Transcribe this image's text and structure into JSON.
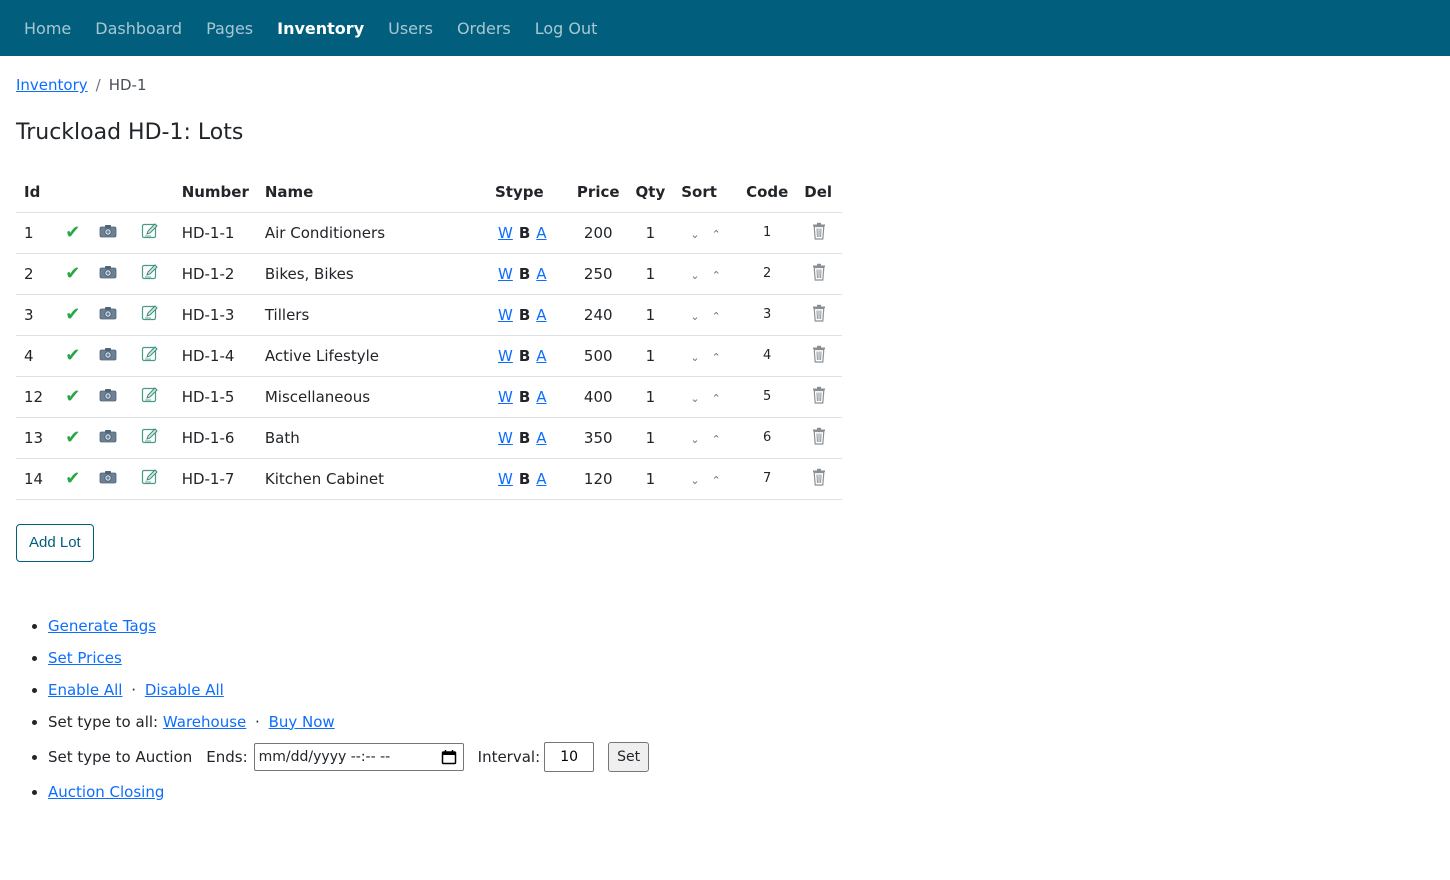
{
  "nav": {
    "items": [
      {
        "label": "Home"
      },
      {
        "label": "Dashboard"
      },
      {
        "label": "Pages"
      },
      {
        "label": "Inventory"
      },
      {
        "label": "Users"
      },
      {
        "label": "Orders"
      },
      {
        "label": "Log Out"
      }
    ],
    "active": "Inventory",
    "bg_color": "#025e7d"
  },
  "breadcrumb": {
    "parent": "Inventory",
    "separator": "/",
    "current": "HD-1"
  },
  "page_title": "Truckload HD-1: Lots",
  "table": {
    "headers": {
      "id": "Id",
      "number": "Number",
      "name": "Name",
      "stype": "Stype",
      "price": "Price",
      "qty": "Qty",
      "sort": "Sort",
      "code": "Code",
      "del": "Del"
    },
    "stype_labels": {
      "w": "W",
      "b": "B",
      "a": "A"
    },
    "sort_icons": {
      "down": "⌄",
      "up": "⌃"
    },
    "icons": {
      "enabled": "check-icon",
      "photo": "camera-icon",
      "edit": "edit-icon",
      "delete": "trash-icon"
    },
    "rows": [
      {
        "id": "1",
        "number": "HD-1-1",
        "name": "Air Conditioners",
        "price": "200",
        "qty": "1",
        "code": "1"
      },
      {
        "id": "2",
        "number": "HD-1-2",
        "name": "Bikes, Bikes",
        "price": "250",
        "qty": "1",
        "code": "2"
      },
      {
        "id": "3",
        "number": "HD-1-3",
        "name": "Tillers",
        "price": "240",
        "qty": "1",
        "code": "3"
      },
      {
        "id": "4",
        "number": "HD-1-4",
        "name": "Active Lifestyle",
        "price": "500",
        "qty": "1",
        "code": "4"
      },
      {
        "id": "12",
        "number": "HD-1-5",
        "name": "Miscellaneous",
        "price": "400",
        "qty": "1",
        "code": "5"
      },
      {
        "id": "13",
        "number": "HD-1-6",
        "name": "Bath",
        "price": "350",
        "qty": "1",
        "code": "6"
      },
      {
        "id": "14",
        "number": "HD-1-7",
        "name": "Kitchen Cabinet",
        "price": "120",
        "qty": "1",
        "code": "7"
      }
    ]
  },
  "add_lot_button": "Add Lot",
  "actions": {
    "generate_tags": "Generate Tags",
    "set_prices": "Set Prices",
    "enable_all": "Enable All",
    "disable_all": "Disable All",
    "separator": "·",
    "set_type_all_label": "Set type to all:",
    "warehouse": "Warehouse",
    "buy_now": "Buy Now",
    "set_type_auction_label": "Set type to Auction",
    "ends_label": "Ends:",
    "ends_placeholder": "mm/dd/yyyy --:-- --",
    "interval_label": "Interval:",
    "interval_value": "10",
    "set_button": "Set",
    "auction_closing": "Auction Closing"
  },
  "colors": {
    "link": "#0d6efd",
    "check": "#28a745",
    "nav_bg": "#025e7d"
  }
}
